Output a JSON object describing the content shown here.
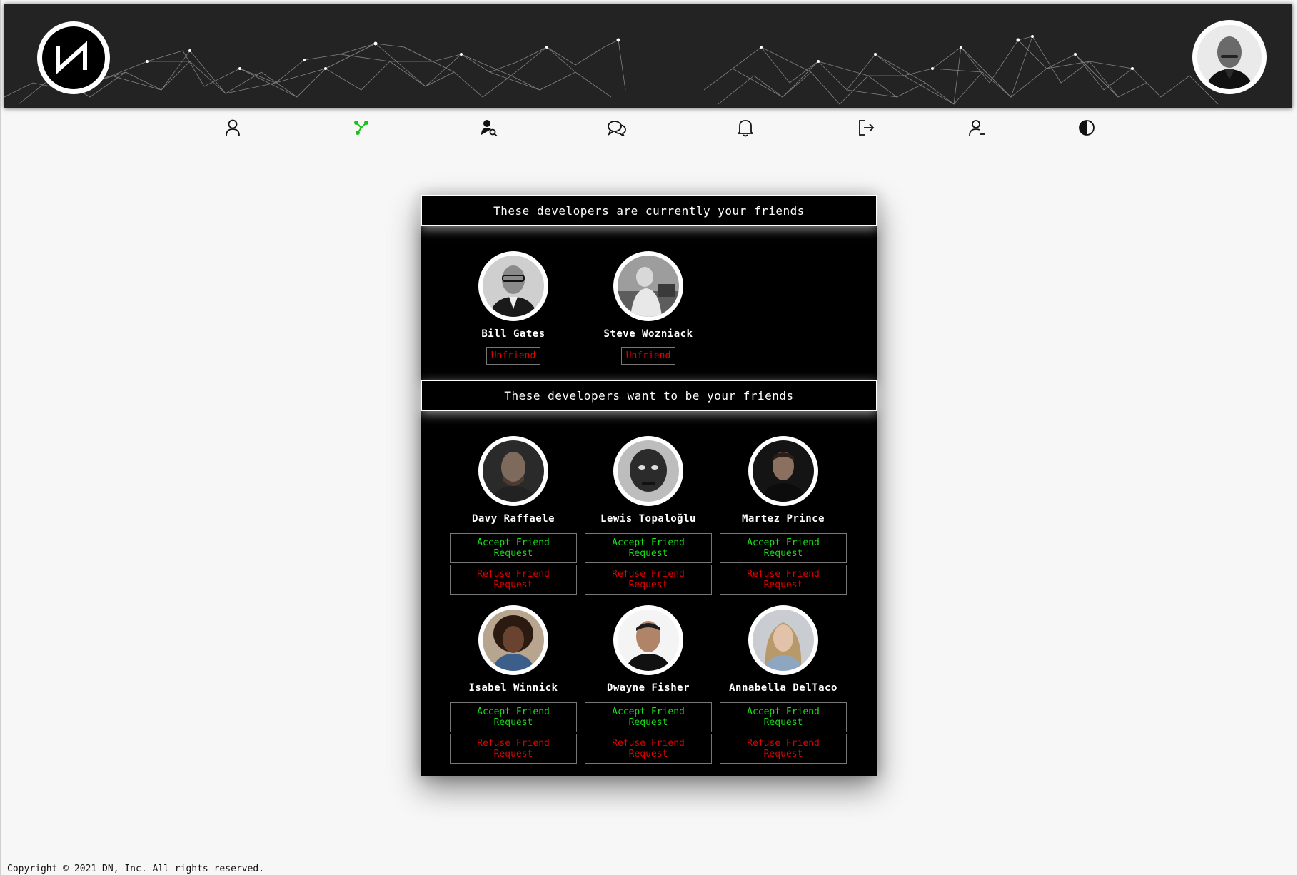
{
  "nav": {
    "items": [
      {
        "name": "profile-icon"
      },
      {
        "name": "network-icon",
        "color": "#18c018"
      },
      {
        "name": "find-developer-icon"
      },
      {
        "name": "chat-icon"
      },
      {
        "name": "bell-icon"
      },
      {
        "name": "logout-icon"
      },
      {
        "name": "remove-user-icon"
      },
      {
        "name": "contrast-icon"
      }
    ]
  },
  "friends": {
    "title": "These developers are currently your friends",
    "unfriend_label": "Unfriend",
    "people": [
      {
        "name": "Bill Gates"
      },
      {
        "name": "Steve Wozniack"
      }
    ]
  },
  "requests": {
    "title": "These developers want to be your friends",
    "accept_label": "Accept Friend Request",
    "refuse_label": "Refuse Friend Request",
    "people": [
      {
        "name": "Davy Raffaele"
      },
      {
        "name": "Lewis Topaloğlu"
      },
      {
        "name": "Martez Prince"
      },
      {
        "name": "Isabel Winnick"
      },
      {
        "name": "Dwayne Fisher"
      },
      {
        "name": "Annabella DelTaco"
      }
    ]
  },
  "colors": {
    "accept": "#18e018",
    "refuse": "#e00000",
    "panel_bg": "#000000",
    "header_bg": "#232323"
  },
  "footer": {
    "copyright": "Copyright © 2021 DN, Inc. All rights reserved."
  }
}
